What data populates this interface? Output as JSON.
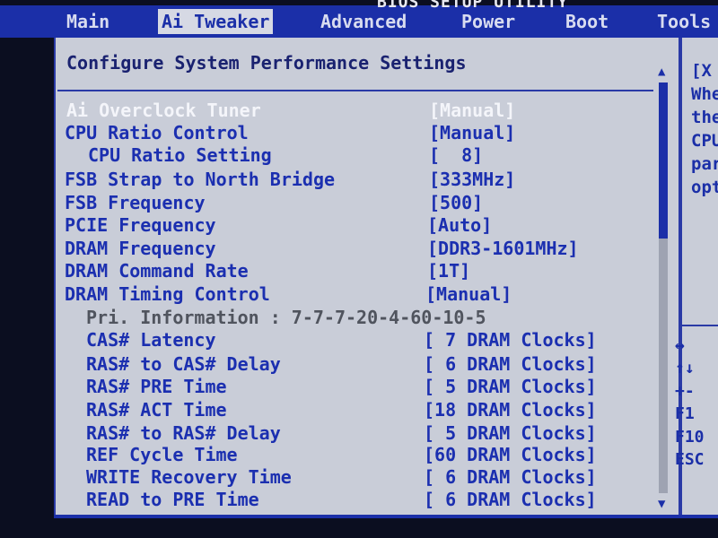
{
  "utility_title": "BIOS SETUP UTILITY",
  "menu": {
    "tabs": [
      {
        "label": "Main"
      },
      {
        "label": "Ai Tweaker"
      },
      {
        "label": "Advanced"
      },
      {
        "label": "Power"
      },
      {
        "label": "Boot"
      },
      {
        "label": "Tools"
      }
    ],
    "active_tab": "Ai Tweaker"
  },
  "section_title": "Configure System Performance Settings",
  "settings": [
    {
      "label": "Ai Overclock Tuner",
      "value": "[Manual]"
    },
    {
      "label": "CPU Ratio Control",
      "value": "[Manual]"
    },
    {
      "label": "CPU Ratio Setting",
      "value": "[  8]"
    },
    {
      "label": "FSB Strap to North Bridge",
      "value": "[333MHz]"
    },
    {
      "label": "FSB Frequency",
      "value": "[500]"
    },
    {
      "label": "PCIE Frequency",
      "value": "[Auto]"
    },
    {
      "label": "DRAM Frequency",
      "value": "[DDR3-1601MHz]"
    },
    {
      "label": "DRAM Command Rate",
      "value": "[1T]"
    },
    {
      "label": "DRAM Timing Control",
      "value": "[Manual]"
    },
    {
      "label": "Pri. Information : 7-7-7-20-4-60-10-5",
      "value": ""
    },
    {
      "label": "CAS# Latency",
      "value": "[ 7 DRAM Clocks]"
    },
    {
      "label": "RAS# to CAS# Delay",
      "value": "[ 6 DRAM Clocks]"
    },
    {
      "label": "RAS# PRE Time",
      "value": "[ 5 DRAM Clocks]"
    },
    {
      "label": "RAS# ACT Time",
      "value": "[18 DRAM Clocks]"
    },
    {
      "label": "RAS# to RAS# Delay",
      "value": "[ 5 DRAM Clocks]"
    },
    {
      "label": "REF Cycle Time",
      "value": "[60 DRAM Clocks]"
    },
    {
      "label": "WRITE Recovery Time",
      "value": "[ 6 DRAM Clocks]"
    },
    {
      "label": "READ to PRE Time",
      "value": "[ 6 DRAM Clocks]"
    }
  ],
  "help_panel": {
    "lines": [
      "[X",
      "Whe",
      "the",
      "CPU",
      "par",
      "opt"
    ]
  },
  "keys": [
    {
      "key": "↔"
    },
    {
      "key": "↑↓"
    },
    {
      "key": "+-"
    },
    {
      "key": "F1"
    },
    {
      "key": "F10"
    },
    {
      "key": "ESC"
    }
  ],
  "scrollbar": {
    "thumb_fraction": 0.38
  },
  "colors": {
    "menubar": "#1b2fa8",
    "background": "#c9cdd8",
    "selected_text": "#f4f5fa",
    "setting_text": "#1b2fb0",
    "info_text": "#50545e"
  }
}
